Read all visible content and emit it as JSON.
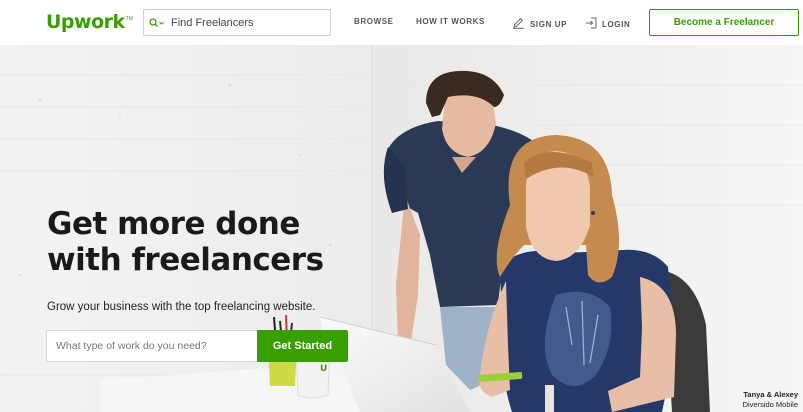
{
  "header": {
    "logo_text": "Upwork",
    "logo_mark": "TM",
    "search": {
      "placeholder": "Find Freelancers",
      "icon": "search-icon"
    },
    "nav": {
      "browse": "BROWSE",
      "how_it_works": "HOW IT WORKS",
      "sign_up": "SIGN UP",
      "login": "LOGIN"
    },
    "become_freelancer": "Become a Freelancer"
  },
  "hero": {
    "headline": "Get more done with freelancers",
    "subtitle": "Grow your business with the top freelancing website.",
    "search_placeholder": "What type of work do you need?",
    "cta": "Get Started",
    "photo_credit_line1": "Tanya & Alexey",
    "photo_credit_line2": "Diversido Mobile"
  },
  "colors": {
    "brand_green": "#37a000",
    "text_dark": "#1a1a1a",
    "nav_text": "#555555",
    "border": "#cfcfcf"
  }
}
